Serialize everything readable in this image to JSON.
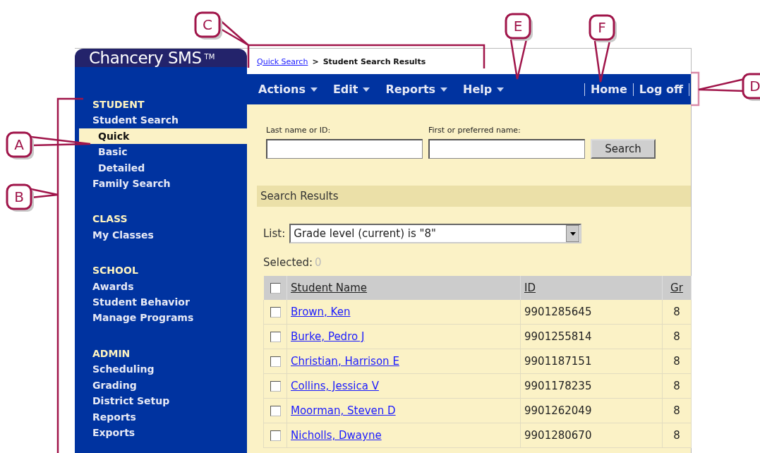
{
  "logo": {
    "name": "Chancery SMS",
    "mark": "TM"
  },
  "breadcrumb": [
    {
      "kind": "link",
      "text": "Quick Search"
    },
    {
      "kind": "separator",
      "text": ">"
    },
    {
      "kind": "current",
      "text": "Student Search Results"
    }
  ],
  "menu": [
    {
      "label": "Actions"
    },
    {
      "label": "Edit"
    },
    {
      "label": "Reports"
    },
    {
      "label": "Help"
    }
  ],
  "links": [
    {
      "label": "Home"
    },
    {
      "label": "Log off"
    }
  ],
  "sidebar": [
    {
      "title": "STUDENT",
      "items": [
        {
          "label": "Student Search",
          "selected": false,
          "children": [
            {
              "label": "Quick",
              "selected": true
            },
            {
              "label": "Basic",
              "selected": false
            },
            {
              "label": "Detailed",
              "selected": false
            }
          ]
        },
        {
          "label": "Family Search",
          "selected": false
        }
      ]
    },
    {
      "title": "CLASS",
      "items": [
        {
          "label": "My Classes",
          "selected": false
        }
      ]
    },
    {
      "title": "SCHOOL",
      "items": [
        {
          "label": "Awards",
          "selected": false
        },
        {
          "label": "Student Behavior",
          "selected": false
        },
        {
          "label": "Manage Programs",
          "selected": false
        }
      ]
    },
    {
      "title": "ADMIN",
      "items": [
        {
          "label": "Scheduling",
          "selected": false
        },
        {
          "label": "Grading",
          "selected": false
        },
        {
          "label": "District Setup",
          "selected": false
        },
        {
          "label": "Reports",
          "selected": false
        },
        {
          "label": "Exports",
          "selected": false
        }
      ]
    }
  ],
  "search": {
    "fields": [
      {
        "label": "Last name or ID:"
      },
      {
        "label": "First or preferred name:"
      }
    ],
    "button": "Search"
  },
  "results": {
    "title": "Search Results",
    "list_label": "List:",
    "list_value": "Grade level (current) is \"8\"",
    "selected_label": "Selected:",
    "selected_count": "0"
  },
  "table": {
    "select_all_checked": false,
    "columns": [
      "Student Name",
      "ID",
      "Gr"
    ],
    "rows": [
      {
        "checked": false,
        "name": "Brown, Ken",
        "id": "9901285645",
        "grade": "8"
      },
      {
        "checked": false,
        "name": "Burke, Pedro J",
        "id": "9901255814",
        "grade": "8"
      },
      {
        "checked": false,
        "name": "Christian, Harrison E",
        "id": "9901187151",
        "grade": "8"
      },
      {
        "checked": false,
        "name": "Collins, Jessica V",
        "id": "9901178235",
        "grade": "8"
      },
      {
        "checked": false,
        "name": "Moorman, Steven D",
        "id": "9901262049",
        "grade": "8"
      },
      {
        "checked": false,
        "name": "Nicholls, Dwayne",
        "id": "9901280670",
        "grade": "8"
      }
    ]
  },
  "callouts": [
    {
      "label": "C"
    },
    {
      "label": "E"
    },
    {
      "label": "F"
    },
    {
      "label": "D"
    },
    {
      "label": "A"
    },
    {
      "label": "B"
    }
  ]
}
